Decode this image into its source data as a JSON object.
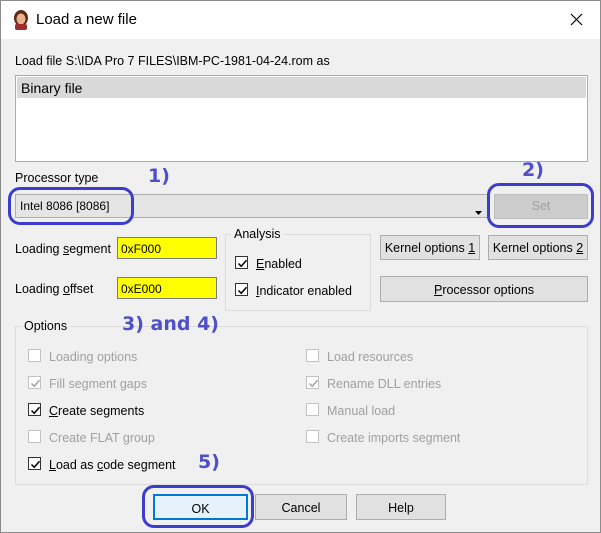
{
  "window": {
    "title": "Load a new file",
    "close_icon": "close-icon",
    "app_icon": "ida-app-icon"
  },
  "load_file": {
    "label": "Load file S:\\IDA Pro 7 FILES\\IBM-PC-1981-04-24.rom as",
    "items": [
      "Binary file"
    ],
    "selected": "Binary file"
  },
  "processor": {
    "label": "Processor type",
    "value": "Intel 8086 [8086]",
    "set_label": "Set"
  },
  "loading": {
    "segment_label": "Loading segment",
    "segment_value": "0xF000",
    "offset_label": "Loading offset",
    "offset_value": "0xE000"
  },
  "analysis": {
    "title": "Analysis",
    "enabled_label": "Enabled",
    "enabled_checked": true,
    "indicator_label": "Indicator enabled",
    "indicator_checked": true
  },
  "buttons": {
    "kernel1": "Kernel options 1",
    "kernel2": "Kernel options 2",
    "processor_options": "Processor options",
    "ok": "OK",
    "cancel": "Cancel",
    "help": "Help"
  },
  "options": {
    "title": "Options",
    "left": [
      {
        "label": "Loading options",
        "checked": false,
        "enabled": false
      },
      {
        "label": "Fill segment gaps",
        "checked": true,
        "enabled": false
      },
      {
        "label": "Create segments",
        "checked": true,
        "enabled": true
      },
      {
        "label": "Create FLAT group",
        "checked": false,
        "enabled": false
      },
      {
        "label": "Load as code segment",
        "checked": true,
        "enabled": true
      }
    ],
    "right": [
      {
        "label": "Load resources",
        "checked": false,
        "enabled": false
      },
      {
        "label": "Rename DLL entries",
        "checked": true,
        "enabled": false
      },
      {
        "label": "Manual load",
        "checked": false,
        "enabled": false
      },
      {
        "label": "Create imports segment",
        "checked": false,
        "enabled": false
      }
    ]
  },
  "annotations": {
    "a1": "1)",
    "a2": "2)",
    "a34": "3) and 4)",
    "a5": "5)",
    "highlight_color": "#3c3ccd"
  }
}
